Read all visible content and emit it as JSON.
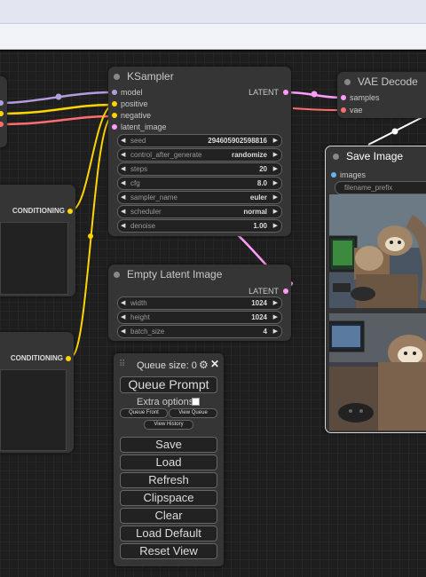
{
  "ksampler": {
    "title": "KSampler",
    "inputs": [
      "model",
      "positive",
      "negative",
      "latent_image"
    ],
    "output": "LATENT",
    "widgets": [
      {
        "label": "seed",
        "value": "294605902598816"
      },
      {
        "label": "control_after_generate",
        "value": "randomize"
      },
      {
        "label": "steps",
        "value": "20"
      },
      {
        "label": "cfg",
        "value": "8.0"
      },
      {
        "label": "sampler_name",
        "value": "euler"
      },
      {
        "label": "scheduler",
        "value": "normal"
      },
      {
        "label": "denoise",
        "value": "1.00"
      }
    ]
  },
  "vae_decode": {
    "title": "VAE Decode",
    "inputs": [
      "samples",
      "vae"
    ]
  },
  "save_image": {
    "title": "Save Image",
    "input": "images",
    "widget_label": "filename_prefix"
  },
  "conditioning_top": {
    "output": "CONDITIONING"
  },
  "conditioning_bottom": {
    "output": "CONDITIONING"
  },
  "empty_latent": {
    "title": "Empty Latent Image",
    "output": "LATENT",
    "widgets": [
      {
        "label": "width",
        "value": "1024"
      },
      {
        "label": "height",
        "value": "1024"
      },
      {
        "label": "batch_size",
        "value": "4"
      }
    ]
  },
  "queue": {
    "size_label": "Queue size: 0",
    "queue_prompt": "Queue Prompt",
    "extra_options": "Extra options",
    "queue_front": "Queue Front",
    "view_queue": "View Queue",
    "view_history": "View History",
    "save": "Save",
    "load": "Load",
    "refresh": "Refresh",
    "clipspace": "Clipspace",
    "clear": "Clear",
    "load_default": "Load Default",
    "reset_view": "Reset View"
  },
  "colors": {
    "model": "#b39ddb",
    "conditioning": "#ffd500",
    "latent": "#ff9cf9",
    "vae": "#ff6e6e",
    "image": "#64b5f6"
  }
}
